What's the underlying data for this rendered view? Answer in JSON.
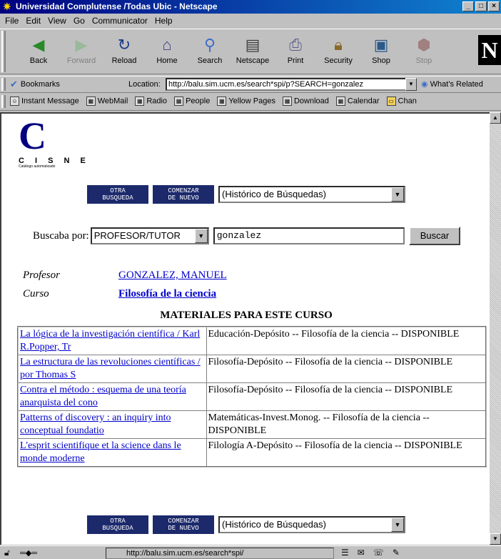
{
  "window": {
    "title": "Universidad Complutense /Todas Ubic - Netscape",
    "controls": [
      "_",
      "□",
      "×"
    ]
  },
  "menu": [
    "File",
    "Edit",
    "View",
    "Go",
    "Communicator",
    "Help"
  ],
  "toolbar": {
    "buttons": [
      {
        "label": "Back",
        "icon": "back-icon",
        "enabled": true
      },
      {
        "label": "Forward",
        "icon": "forward-icon",
        "enabled": false
      },
      {
        "label": "Reload",
        "icon": "reload-icon",
        "enabled": true
      },
      {
        "label": "Home",
        "icon": "home-icon",
        "enabled": true
      },
      {
        "label": "Search",
        "icon": "search-icon",
        "enabled": true
      },
      {
        "label": "Netscape",
        "icon": "netscape-icon",
        "enabled": true
      },
      {
        "label": "Print",
        "icon": "print-icon",
        "enabled": true
      },
      {
        "label": "Security",
        "icon": "security-icon",
        "enabled": true
      },
      {
        "label": "Shop",
        "icon": "shop-icon",
        "enabled": true
      },
      {
        "label": "Stop",
        "icon": "stop-icon",
        "enabled": false
      }
    ],
    "logo": "N"
  },
  "location": {
    "bookmarks_label": "Bookmarks",
    "label": "Location:",
    "url": "http://balu.sim.ucm.es/search*spi/p?SEARCH=gonzalez",
    "whats_related": "What's Related"
  },
  "personal_toolbar": [
    "Instant Message",
    "WebMail",
    "Radio",
    "People",
    "Yellow Pages",
    "Download",
    "Calendar",
    "Chan"
  ],
  "page": {
    "logo_text": "C I S N E",
    "logo_sub": "Catálogo automatizado",
    "btn_otra": "OTRA\nBUSQUEDA",
    "btn_comenzar": "COMENZAR\nDE NUEVO",
    "historico": "(Histórico de Búsquedas)",
    "search_label": "Buscaba por:",
    "search_type": "PROFESOR/TUTOR",
    "search_value": "gonzalez",
    "search_button": "Buscar",
    "profesor_label": "Profesor",
    "profesor_value": "GONZALEZ, MANUEL",
    "curso_label": "Curso",
    "curso_value": "Filosofía de la ciencia",
    "materials_title": "MATERIALES PARA ESTE CURSO",
    "materials": [
      {
        "title": "La lógica de la investigación científica / Karl R.Popper, Tr",
        "location": "Educación-Depósito -- Filosofía de la ciencia -- DISPONIBLE"
      },
      {
        "title": "La estructura de las revoluciones científicas / por Thomas S",
        "location": "Filosofía-Depósito -- Filosofía de la ciencia -- DISPONIBLE"
      },
      {
        "title": "Contra el método : esquema de una teoría anarquista del cono",
        "location": "Filosofía-Depósito -- Filosofía de la ciencia -- DISPONIBLE"
      },
      {
        "title": "Patterns of discovery : an inquiry into conceptual foundatio",
        "location": "Matemáticas-Invest.Monog. -- Filosofía de la ciencia -- DISPONIBLE"
      },
      {
        "title": "L'esprit scientifique et la science dans le monde moderne",
        "location": "Filología A-Depósito -- Filosofía de la ciencia -- DISPONIBLE"
      }
    ]
  },
  "status": {
    "url": "http://balu.sim.ucm.es/search*spi/"
  }
}
